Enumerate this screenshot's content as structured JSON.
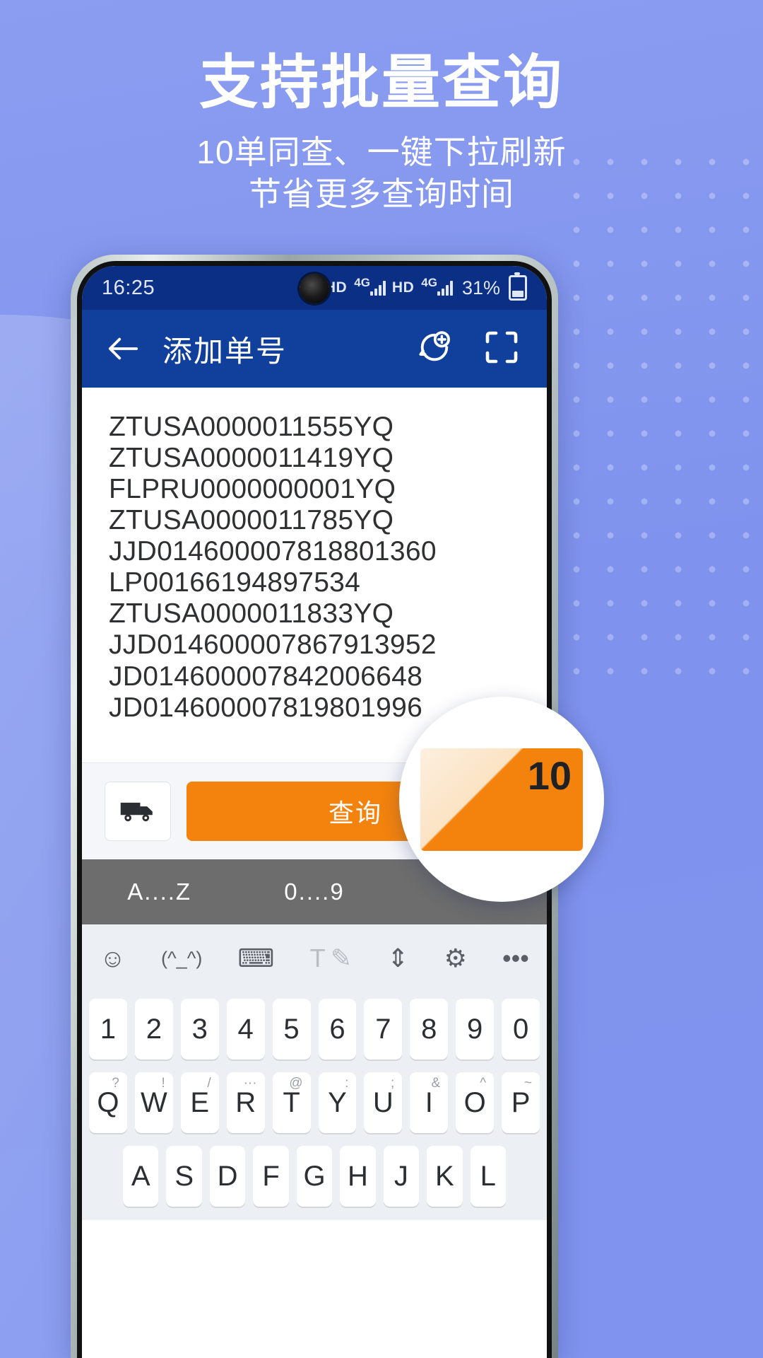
{
  "promo": {
    "headline": "支持批量查询",
    "subtitle_line1": "10单同查、一键下拉刷新",
    "subtitle_line2": "节省更多查询时间",
    "accent_color": "#f4830d",
    "brand_color": "#10409b",
    "background_color": "#8094ee"
  },
  "status_bar": {
    "time": "16:25",
    "wifi_icon": "wifi-icon",
    "sim1_hd": "HD",
    "sim1_network": "4G",
    "sim2_hd": "HD",
    "sim2_network": "4G",
    "battery_percent": "31%",
    "battery_icon": "battery-icon"
  },
  "app_bar": {
    "back_icon": "back-arrow-icon",
    "title": "添加单号",
    "action_photo_icon": "photo-recognize-icon",
    "action_scan_icon": "scan-qr-icon"
  },
  "tracking_numbers": [
    "ZTUSA0000011555YQ",
    "ZTUSA0000011419YQ",
    "FLPRU0000000001YQ",
    "ZTUSA0000011785YQ",
    "JJD014600007818801360",
    "LP00166194897534",
    "ZTUSA0000011833YQ",
    "JJD014600007867913952",
    "JD014600007842006648",
    "JD014600007819801996"
  ],
  "action_bar": {
    "courier_icon": "truck-icon",
    "query_label": "查询"
  },
  "magnifier": {
    "count": "10"
  },
  "keyboard": {
    "tabs": [
      "A....Z",
      "0....9"
    ],
    "tools": [
      "emoji-icon",
      "(^_^)",
      "keyboard-icon",
      "handwriting-icon",
      "move-icon",
      "gear-icon",
      "more-icon"
    ],
    "number_row": [
      "1",
      "2",
      "3",
      "4",
      "5",
      "6",
      "7",
      "8",
      "9",
      "0"
    ],
    "letter_row": [
      {
        "key": "Q",
        "sup": "?"
      },
      {
        "key": "W",
        "sup": "!"
      },
      {
        "key": "E",
        "sup": "/"
      },
      {
        "key": "R",
        "sup": "···"
      },
      {
        "key": "T",
        "sup": "@"
      },
      {
        "key": "Y",
        "sup": ":"
      },
      {
        "key": "U",
        "sup": ";"
      },
      {
        "key": "I",
        "sup": "&"
      },
      {
        "key": "O",
        "sup": "^"
      },
      {
        "key": "P",
        "sup": "~"
      }
    ],
    "third_row": [
      "A",
      "S",
      "D",
      "F",
      "G",
      "H",
      "J",
      "K",
      "L"
    ]
  }
}
